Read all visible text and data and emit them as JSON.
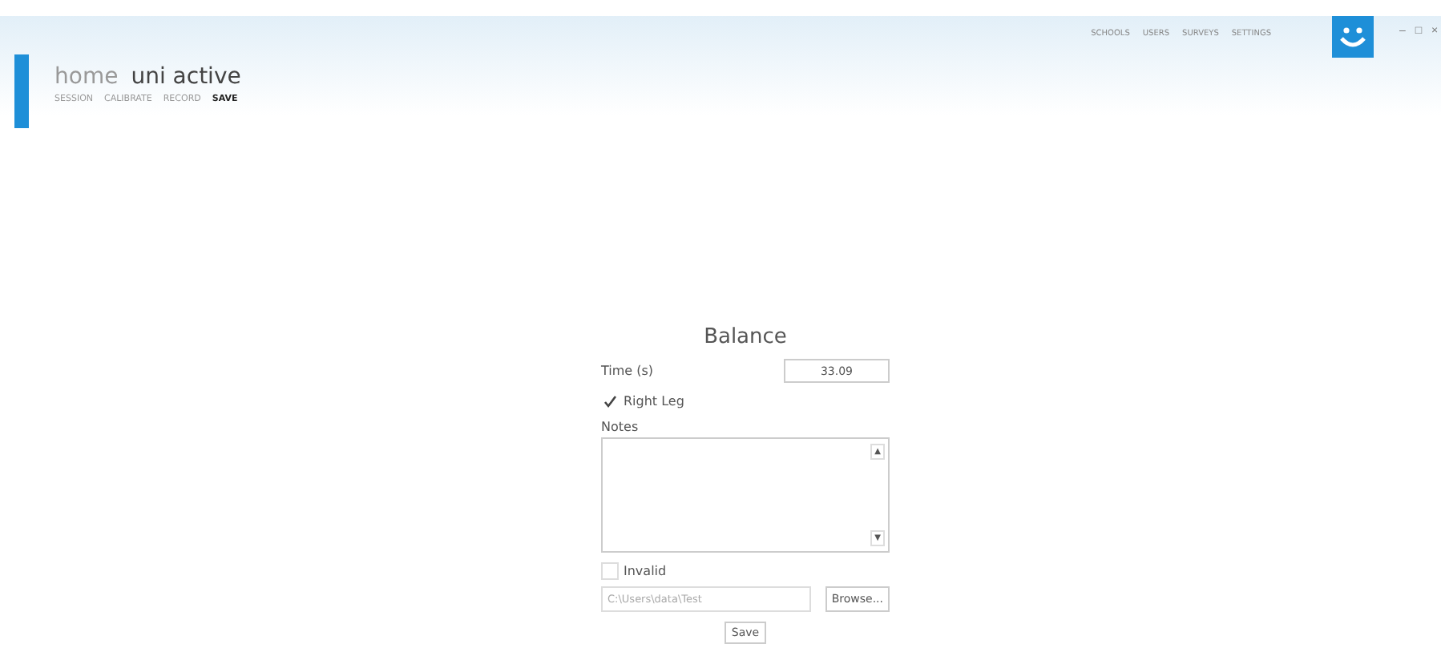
{
  "header": {
    "breadcrumb": "home",
    "title": "uni active",
    "nav": [
      {
        "label": "SESSION",
        "selected": false
      },
      {
        "label": "CALIBRATE",
        "selected": false
      },
      {
        "label": "RECORD",
        "selected": false
      },
      {
        "label": "SAVE",
        "selected": true
      }
    ],
    "top_links": [
      "SCHOOLS",
      "USERS",
      "SURVEYS",
      "SETTINGS"
    ],
    "window_controls": [
      "–",
      "□",
      "×"
    ]
  },
  "form": {
    "title": "Balance",
    "time_label": "Time (s)",
    "time_value": "33.09",
    "right_leg": {
      "label": "Right Leg",
      "checked": true
    },
    "notes_label": "Notes",
    "scroll_up": "▲",
    "scroll_down": "▼",
    "invalid": {
      "label": "Invalid",
      "checked": false
    },
    "path_value": "C:\\Users\\data\\Test",
    "browse": "Browse...",
    "save": "Save"
  }
}
